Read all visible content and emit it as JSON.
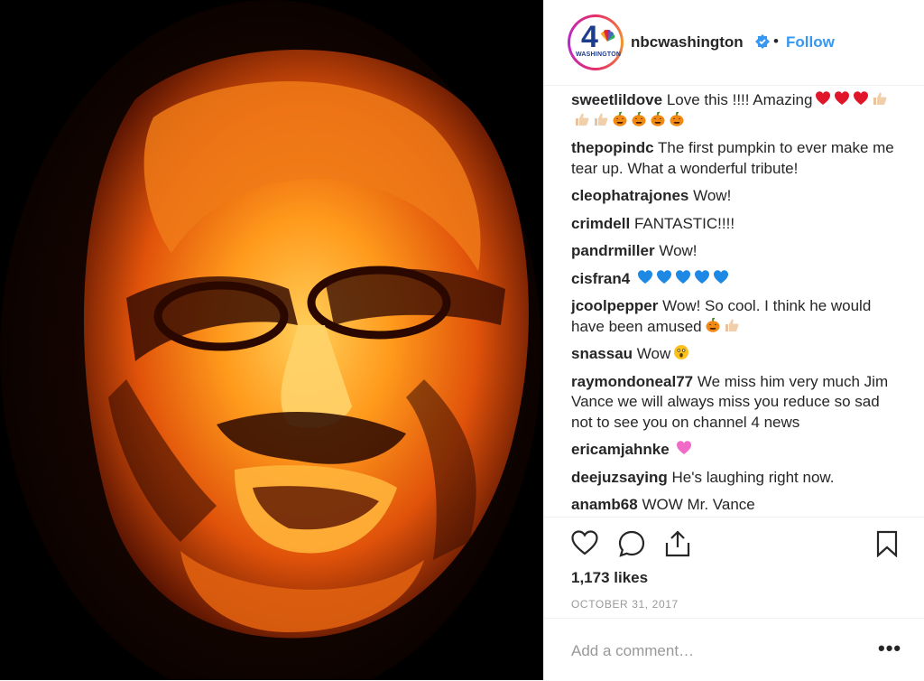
{
  "post": {
    "username": "nbcwashington",
    "follow_label": "Follow",
    "separator": "•",
    "logo_number": "4",
    "logo_word": "WASHINGTON"
  },
  "comments": [
    {
      "user": "sweetlildove",
      "text": "Love this !!!! Amazing",
      "emojis": [
        "heart",
        "heart",
        "heart",
        "thumbs",
        "thumbs",
        "thumbs",
        "pumpkin",
        "pumpkin",
        "pumpkin",
        "pumpkin"
      ]
    },
    {
      "user": "thepopindc",
      "text": "The first pumpkin to ever make me tear up. What a wonderful tribute!",
      "emojis": []
    },
    {
      "user": "cleophatrajones",
      "text": "Wow!",
      "emojis": []
    },
    {
      "user": "crimdell",
      "text": "FANTASTIC!!!!",
      "emojis": []
    },
    {
      "user": "pandrmiller",
      "text": "Wow!",
      "emojis": []
    },
    {
      "user": "cisfran4",
      "text": "",
      "emojis": [
        "blueheart",
        "blueheart",
        "blueheart",
        "blueheart",
        "blueheart"
      ]
    },
    {
      "user": "jcoolpepper",
      "text": "Wow! So cool. I think he would have been amused",
      "emojis": [
        "pumpkin",
        "thumbs"
      ]
    },
    {
      "user": "snassau",
      "text": "Wow",
      "emojis": [
        "astonished"
      ]
    },
    {
      "user": "raymondoneal77",
      "text": "We miss him very much Jim Vance we will always miss you reduce so sad not to see you on channel 4 news",
      "emojis": []
    },
    {
      "user": "ericamjahnke",
      "text": "",
      "emojis": [
        "pinkheart"
      ]
    },
    {
      "user": "deejuzsaying",
      "text": "He's laughing right now.",
      "emojis": []
    },
    {
      "user": "anamb68",
      "text": "WOW Mr. Vance",
      "emojis": []
    }
  ],
  "stats": {
    "likes": "1,173 likes",
    "date": "OCTOBER 31, 2017"
  },
  "composer": {
    "placeholder": "Add a comment…",
    "more": "•••"
  },
  "colors": {
    "link": "#3897f0",
    "muted": "#999999",
    "text": "#262626"
  },
  "icons": {
    "like": "heart-outline-icon",
    "comment": "speech-bubble-icon",
    "share": "share-upload-icon",
    "save": "bookmark-icon",
    "verified": "verified-badge-icon"
  }
}
